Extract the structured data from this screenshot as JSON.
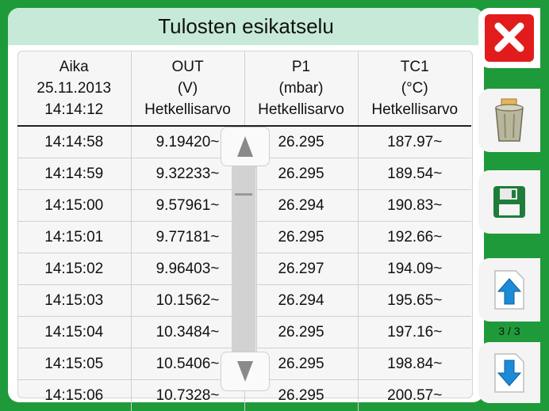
{
  "title": "Tulosten esikatselu",
  "columns": [
    {
      "line1": "Aika",
      "line2": "25.11.2013",
      "line3": "14:14:12"
    },
    {
      "line1": "OUT",
      "line2": "(V)",
      "line3": "Hetkellisarvo"
    },
    {
      "line1": "P1",
      "line2": "(mbar)",
      "line3": "Hetkellisarvo"
    },
    {
      "line1": "TC1",
      "line2": "(°C)",
      "line3": "Hetkellisarvo"
    }
  ],
  "rows": [
    [
      "14:14:58",
      "9.19420~",
      "26.295",
      "187.97~"
    ],
    [
      "14:14:59",
      "9.32233~",
      "26.295",
      "189.54~"
    ],
    [
      "14:15:00",
      "9.57961~",
      "26.294",
      "190.83~"
    ],
    [
      "14:15:01",
      "9.77181~",
      "26.295",
      "192.66~"
    ],
    [
      "14:15:02",
      "9.96403~",
      "26.297",
      "194.09~"
    ],
    [
      "14:15:03",
      "10.1562~",
      "26.294",
      "195.65~"
    ],
    [
      "14:15:04",
      "10.3484~",
      "26.295",
      "197.16~"
    ],
    [
      "14:15:05",
      "10.5406~",
      "26.295",
      "198.84~"
    ],
    [
      "14:15:06",
      "10.7328~",
      "26.295",
      "200.57~"
    ]
  ],
  "pager": {
    "label": "3 / 3"
  },
  "colors": {
    "background": "#1f9a3a",
    "titlebar": "#c6ead7",
    "close": "#e21c1c",
    "arrow": "#1d8ad8"
  },
  "icons": {
    "close": "close-icon",
    "trash": "trash-icon",
    "save": "save-icon",
    "page_up": "page-up-icon",
    "page_down": "page-down-icon",
    "scroll_up": "scroll-up-icon",
    "scroll_down": "scroll-down-icon"
  }
}
